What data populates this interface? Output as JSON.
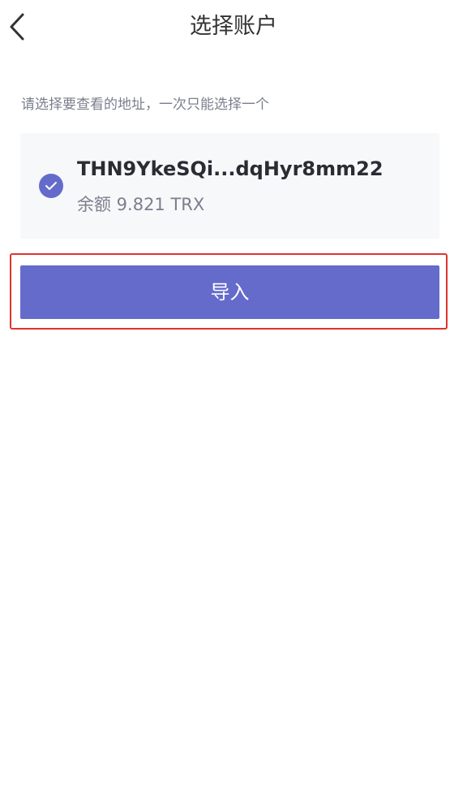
{
  "header": {
    "title": "选择账户",
    "back_icon": "chevron-left-icon"
  },
  "hint": "请选择要查看的地址，一次只能选择一个",
  "accounts": [
    {
      "address": "THN9YkeSQi...dqHyr8mm22",
      "balance_label": "余额 9.821 TRX",
      "selected": true,
      "check_icon": "check-circle-icon"
    }
  ],
  "actions": {
    "import_label": "导入"
  },
  "colors": {
    "accent": "#646bcb",
    "highlight": "#e0332e",
    "card_bg": "#f7f8fa",
    "muted_text": "#7a7f8c"
  }
}
